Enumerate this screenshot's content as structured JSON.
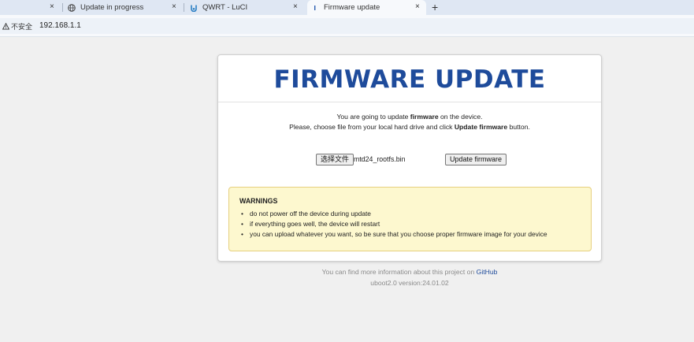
{
  "browser": {
    "tabs": [
      {
        "label": "",
        "icon": "blank-page-icon",
        "active": false
      },
      {
        "label": "Update in progress",
        "icon": "globe-icon",
        "active": false
      },
      {
        "label": "QWRT - LuCI",
        "icon": "luci-logo-icon",
        "active": false
      },
      {
        "label": "Firmware update",
        "icon": "page-icon",
        "active": true
      }
    ],
    "close_glyph": "×",
    "new_tab_glyph": "+",
    "security_label": "不安全",
    "url": "192.168.1.1"
  },
  "page": {
    "title": "FIRMWARE UPDATE",
    "intro": {
      "line1_pre": "You are going to update ",
      "line1_bold": "firmware",
      "line1_post": " on the device.",
      "line2_pre": "Please, choose file from your local hard drive and click ",
      "line2_bold": "Update firmware",
      "line2_post": " button."
    },
    "form": {
      "choose_label": "选择文件",
      "filename": "mtd24_rootfs.bin",
      "update_label": "Update firmware"
    },
    "warnings": {
      "title": "WARNINGS",
      "items": [
        "do not power off the device during update",
        "if everything goes well, the device will restart",
        "you can upload whatever you want, so be sure that you choose proper firmware image for your device"
      ]
    },
    "footer": {
      "text": "You can find more information about this project on ",
      "link": "GitHub",
      "version": "uboot2.0 version:24.01.02"
    }
  },
  "colors": {
    "title": "#1e4b9b",
    "warning_bg": "#fdf8cf",
    "warning_border": "#e6cf7e",
    "tabstrip_bg": "#dfe7f3"
  }
}
